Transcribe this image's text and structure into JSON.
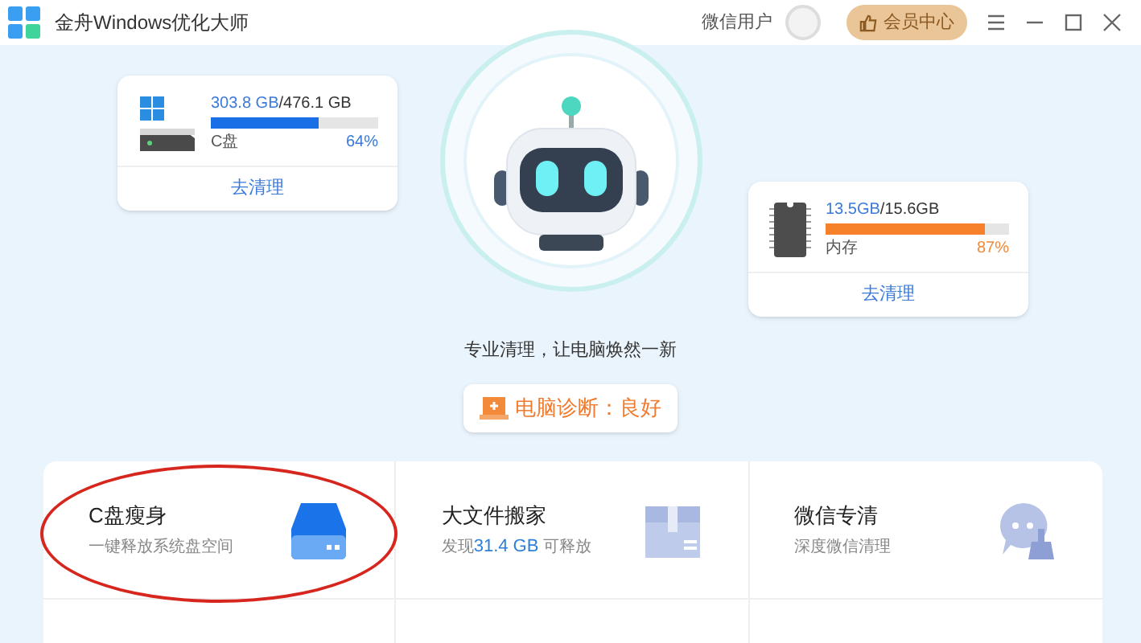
{
  "window": {
    "title": "金舟Windows优化大师",
    "user": "微信用户",
    "vip_button": "会员中心"
  },
  "disk_card": {
    "used": "303.8 GB",
    "total": "/476.1 GB",
    "level": 0.64,
    "label": "C盘",
    "percent": "64%",
    "action": "去清理"
  },
  "memory_card": {
    "used": "13.5GB",
    "total": "/15.6GB",
    "level": 0.87,
    "label": "内存",
    "percent": "87%",
    "action": "去清理"
  },
  "tagline": "专业清理，让电脑焕然一新",
  "diagnosis": "电脑诊断：良好",
  "tools": [
    {
      "kind": "disk",
      "title": "C盘瘦身",
      "subtitle": "一键释放系统盘空间",
      "highlighted": true
    },
    {
      "kind": "box",
      "title": "大文件搬家",
      "subtitle": "发现**31.4 GB** 可释放",
      "highlighted": false
    },
    {
      "kind": "chat",
      "title": "微信专清",
      "subtitle": "深度微信清理",
      "highlighted": false
    }
  ]
}
